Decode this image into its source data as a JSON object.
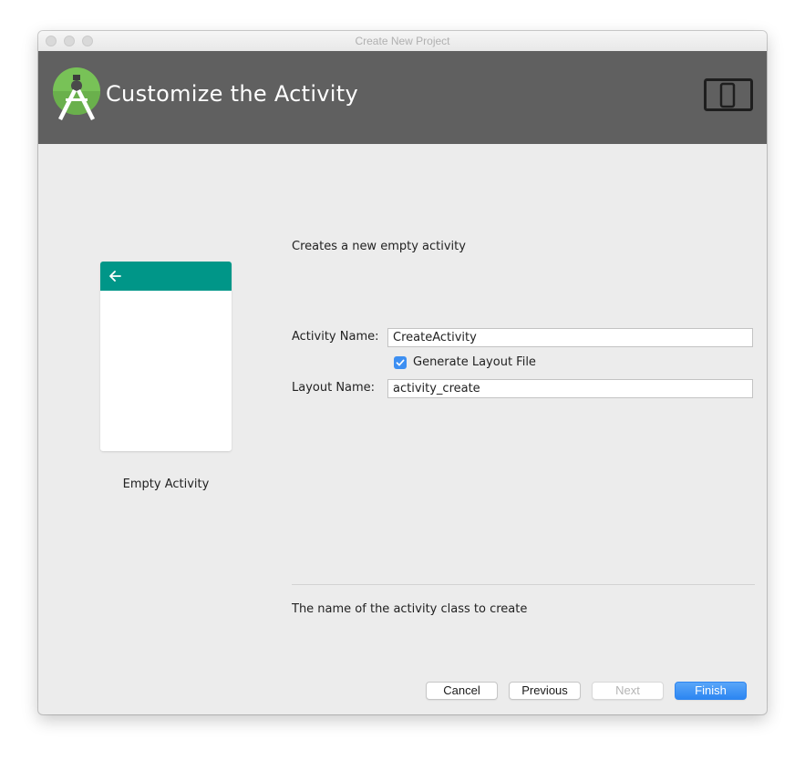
{
  "window": {
    "title": "Create New Project"
  },
  "header": {
    "title": "Customize the Activity",
    "logo_icon": "android-studio-icon",
    "device_icon": "tablet-phone-icon"
  },
  "preview": {
    "label": "Empty Activity",
    "toolbar_color": "#009688",
    "back_icon": "arrow-left-icon"
  },
  "form": {
    "description": "Creates a new empty activity",
    "activity_name_label": "Activity Name:",
    "activity_name_value": "CreateActivity",
    "generate_layout_label": "Generate Layout File",
    "generate_layout_checked": true,
    "layout_name_label": "Layout Name:",
    "layout_name_value": "activity_create",
    "help_text": "The name of the activity class to create"
  },
  "buttons": {
    "cancel": "Cancel",
    "previous": "Previous",
    "next": "Next",
    "finish": "Finish"
  },
  "colors": {
    "header_bg": "#606060",
    "accent": "#3d8ff2",
    "finish_button": "#2c86f2"
  }
}
